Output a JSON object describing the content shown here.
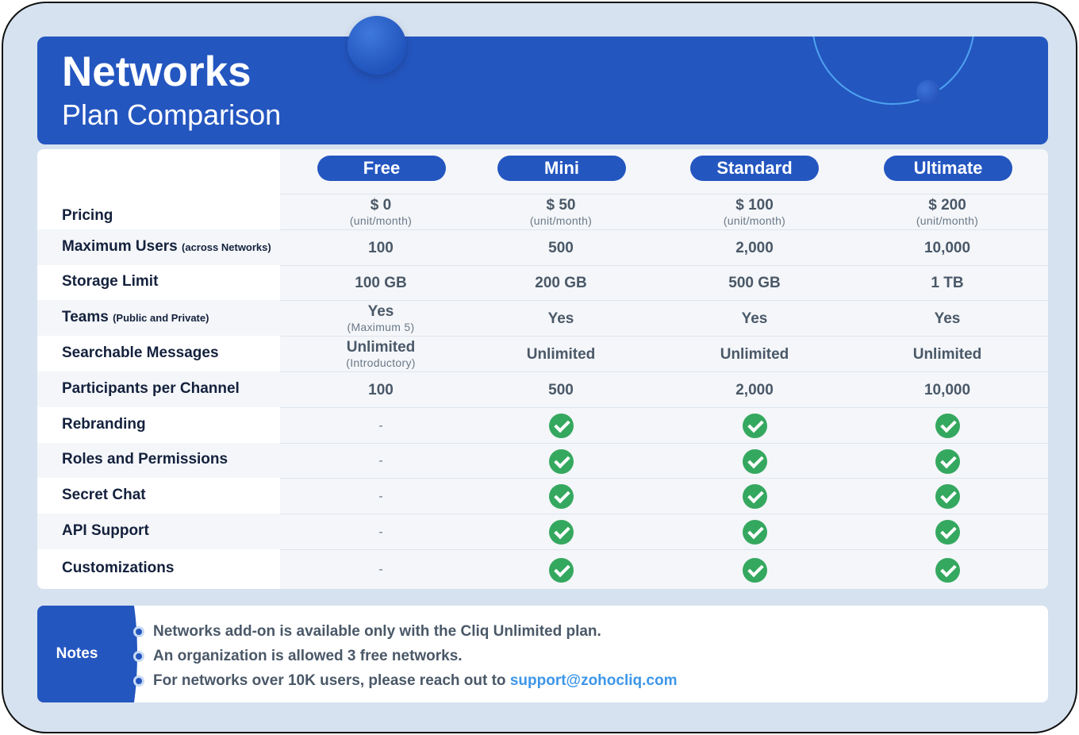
{
  "header": {
    "title": "Networks",
    "subtitle": "Plan Comparison"
  },
  "plans": [
    "Free",
    "Mini",
    "Standard",
    "Ultimate"
  ],
  "rows": [
    {
      "feature": "Pricing",
      "feature_note": "",
      "cells": [
        {
          "main": "$ 0",
          "sub": "(unit/month)"
        },
        {
          "main": "$ 50",
          "sub": "(unit/month)"
        },
        {
          "main": "$ 100",
          "sub": "(unit/month)"
        },
        {
          "main": "$ 200",
          "sub": "(unit/month)"
        }
      ]
    },
    {
      "feature": "Maximum Users",
      "feature_note": "(across Networks)",
      "cells": [
        {
          "main": "100"
        },
        {
          "main": "500"
        },
        {
          "main": "2,000"
        },
        {
          "main": "10,000"
        }
      ]
    },
    {
      "feature": "Storage Limit",
      "feature_note": "",
      "cells": [
        {
          "main": "100 GB"
        },
        {
          "main": "200 GB"
        },
        {
          "main": "500 GB"
        },
        {
          "main": "1 TB"
        }
      ]
    },
    {
      "feature": "Teams",
      "feature_note": "(Public and Private)",
      "cells": [
        {
          "main": "Yes",
          "sub": "(Maximum 5)"
        },
        {
          "main": "Yes"
        },
        {
          "main": "Yes"
        },
        {
          "main": "Yes"
        }
      ]
    },
    {
      "feature": "Searchable Messages",
      "feature_note": "",
      "cells": [
        {
          "main": "Unlimited",
          "sub": "(Introductory)"
        },
        {
          "main": "Unlimited"
        },
        {
          "main": "Unlimited"
        },
        {
          "main": "Unlimited"
        }
      ]
    },
    {
      "feature": "Participants per Channel",
      "feature_note": "",
      "cells": [
        {
          "main": "100"
        },
        {
          "main": "500"
        },
        {
          "main": "2,000"
        },
        {
          "main": "10,000"
        }
      ]
    },
    {
      "feature": "Rebranding",
      "feature_note": "",
      "cells": [
        {
          "dash": "-"
        },
        {
          "check": true
        },
        {
          "check": true
        },
        {
          "check": true
        }
      ]
    },
    {
      "feature": "Roles and Permissions",
      "feature_note": "",
      "cells": [
        {
          "dash": "-"
        },
        {
          "check": true
        },
        {
          "check": true
        },
        {
          "check": true
        }
      ]
    },
    {
      "feature": "Secret Chat",
      "feature_note": "",
      "cells": [
        {
          "dash": "-"
        },
        {
          "check": true
        },
        {
          "check": true
        },
        {
          "check": true
        }
      ]
    },
    {
      "feature": "API Support",
      "feature_note": "",
      "cells": [
        {
          "dash": "-"
        },
        {
          "check": true
        },
        {
          "check": true
        },
        {
          "check": true
        }
      ]
    },
    {
      "feature": "Customizations",
      "feature_note": "",
      "cells": [
        {
          "dash": "-"
        },
        {
          "check": true
        },
        {
          "check": true
        },
        {
          "check": true
        }
      ]
    }
  ],
  "notes": {
    "label": "Notes",
    "items": [
      "Networks add-on is available only with the Cliq Unlimited plan.",
      "An organization is allowed 3 free networks.",
      "For networks over 10K users, please reach out to"
    ],
    "link": "support@zohocliq.com"
  },
  "colors": {
    "brand": "#2456c0",
    "check": "#35a85f",
    "link": "#3d96e8",
    "background": "#d6e2f0"
  }
}
